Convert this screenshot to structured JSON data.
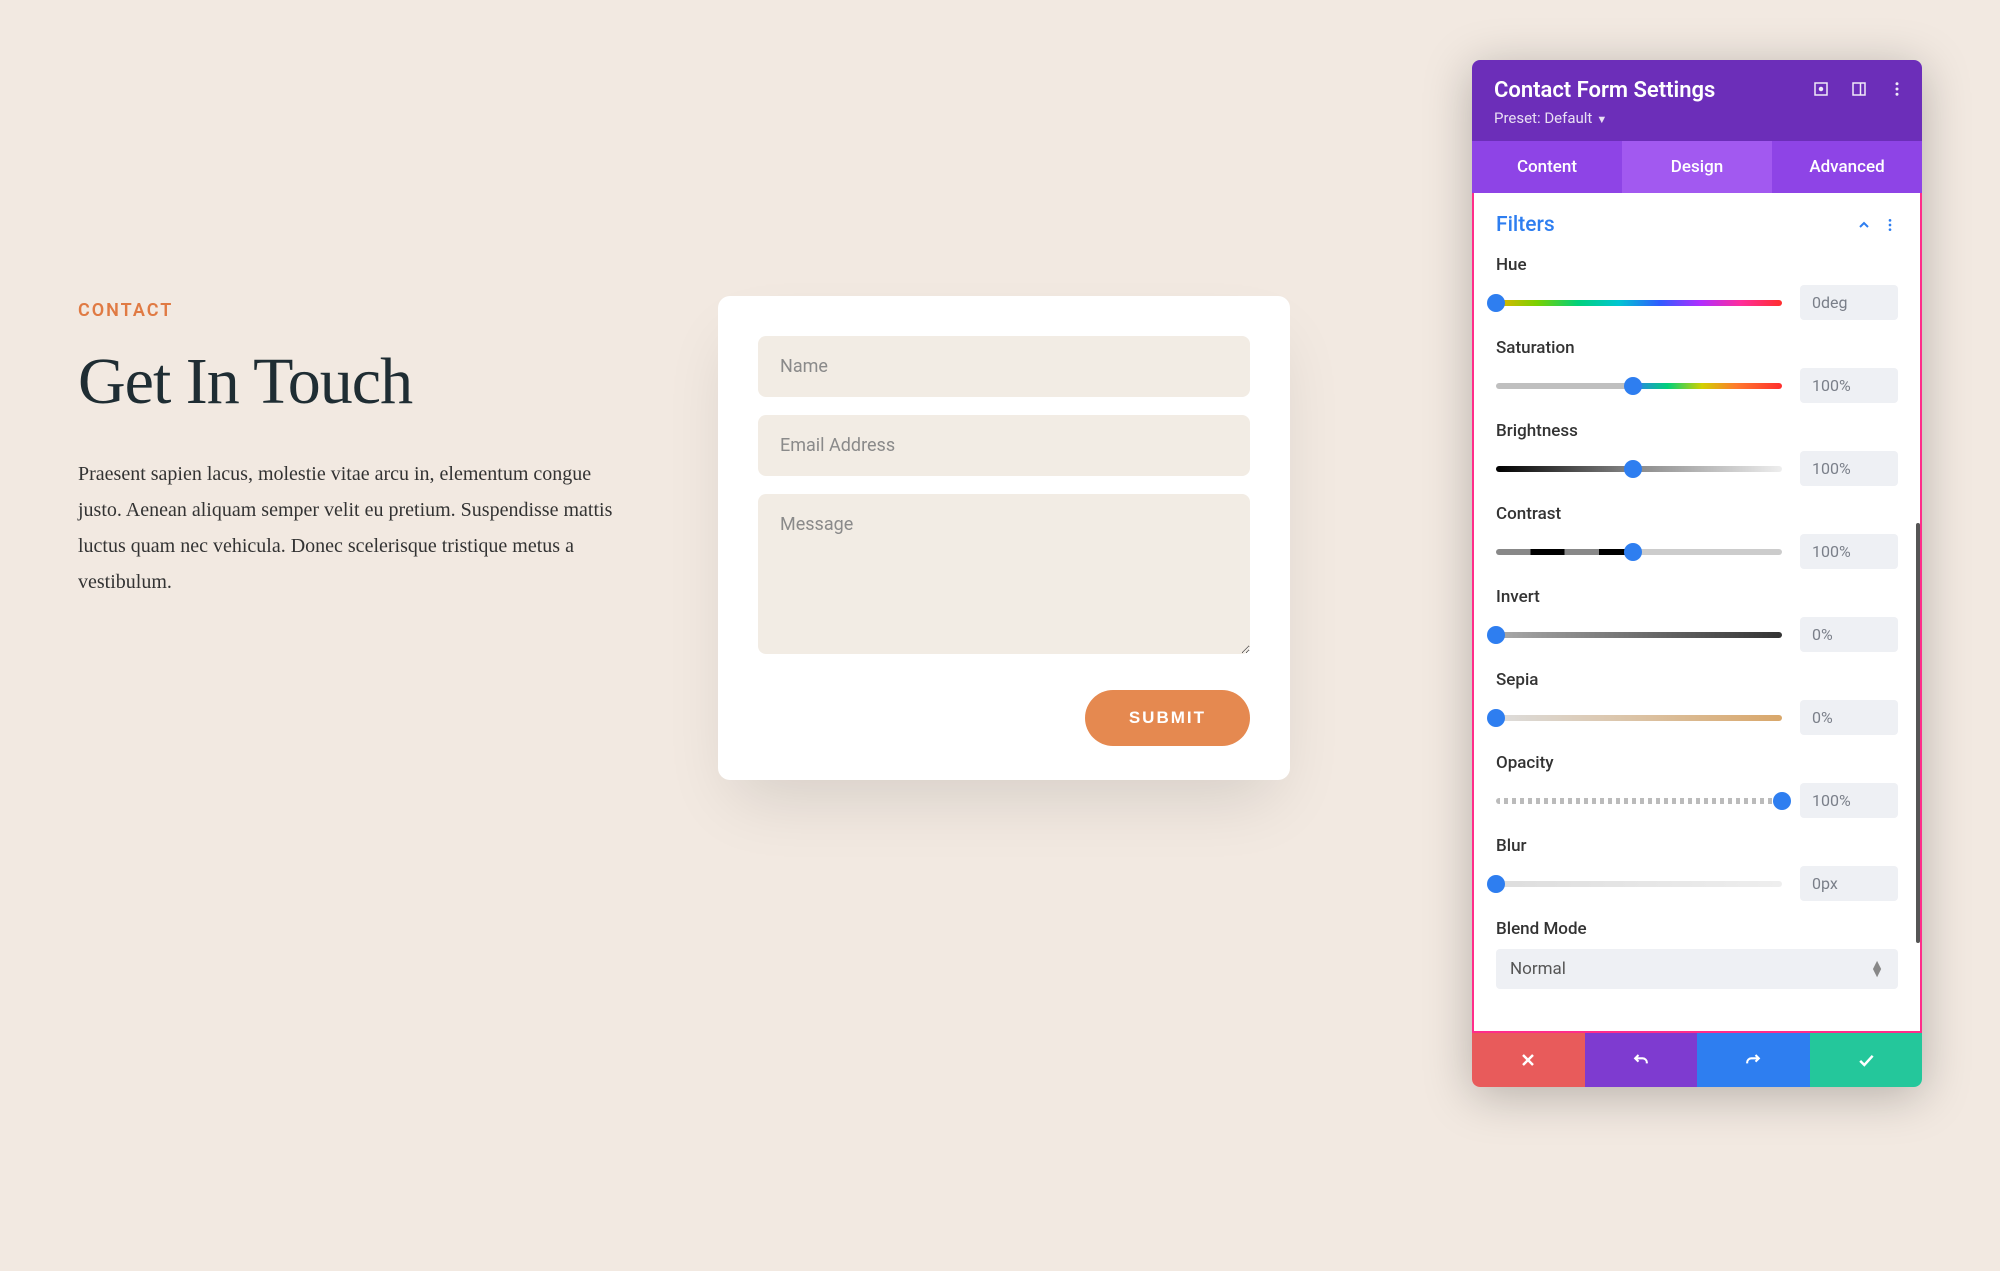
{
  "content": {
    "eyebrow": "CONTACT",
    "heading": "Get In Touch",
    "body": "Praesent sapien lacus, molestie vitae arcu in, elementum congue justo. Aenean aliquam semper velit eu pretium. Suspendisse mattis luctus quam nec vehicula. Donec scelerisque tristique metus a vestibulum."
  },
  "form": {
    "name_placeholder": "Name",
    "email_placeholder": "Email Address",
    "message_placeholder": "Message",
    "submit_label": "SUBMIT"
  },
  "panel": {
    "title": "Contact Form Settings",
    "preset_label": "Preset: Default",
    "tabs": {
      "content": "Content",
      "design": "Design",
      "advanced": "Advanced"
    },
    "section_title": "Filters",
    "filters": {
      "hue": {
        "label": "Hue",
        "value": "0deg",
        "pos": 0
      },
      "saturation": {
        "label": "Saturation",
        "value": "100%",
        "pos": 48
      },
      "brightness": {
        "label": "Brightness",
        "value": "100%",
        "pos": 48
      },
      "contrast": {
        "label": "Contrast",
        "value": "100%",
        "pos": 48
      },
      "invert": {
        "label": "Invert",
        "value": "0%",
        "pos": 0
      },
      "sepia": {
        "label": "Sepia",
        "value": "0%",
        "pos": 0
      },
      "opacity": {
        "label": "Opacity",
        "value": "100%",
        "pos": 100
      },
      "blur": {
        "label": "Blur",
        "value": "0px",
        "pos": 0
      }
    },
    "blend_mode": {
      "label": "Blend Mode",
      "value": "Normal"
    }
  }
}
